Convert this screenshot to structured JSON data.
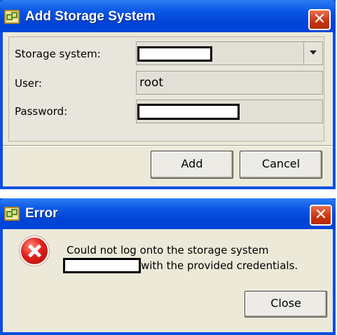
{
  "add_dialog": {
    "title": "Add Storage System",
    "close_glyph": "✕",
    "storage_system_label": "Storage system:",
    "storage_system_value": "",
    "user_label": "User:",
    "user_value": "root",
    "password_label": "Password:",
    "password_value": "",
    "add_button": "Add",
    "cancel_button": "Cancel"
  },
  "error_dialog": {
    "title": "Error",
    "close_glyph": "✕",
    "message_line1": "Could not log onto the storage system",
    "message_line2": "with the provided credentials.",
    "close_button": "Close",
    "icon": "error-icon"
  },
  "colors": {
    "titlebar": "#0a56e6",
    "close_button": "#c8330f",
    "dialog_background": "#ece9d8"
  }
}
